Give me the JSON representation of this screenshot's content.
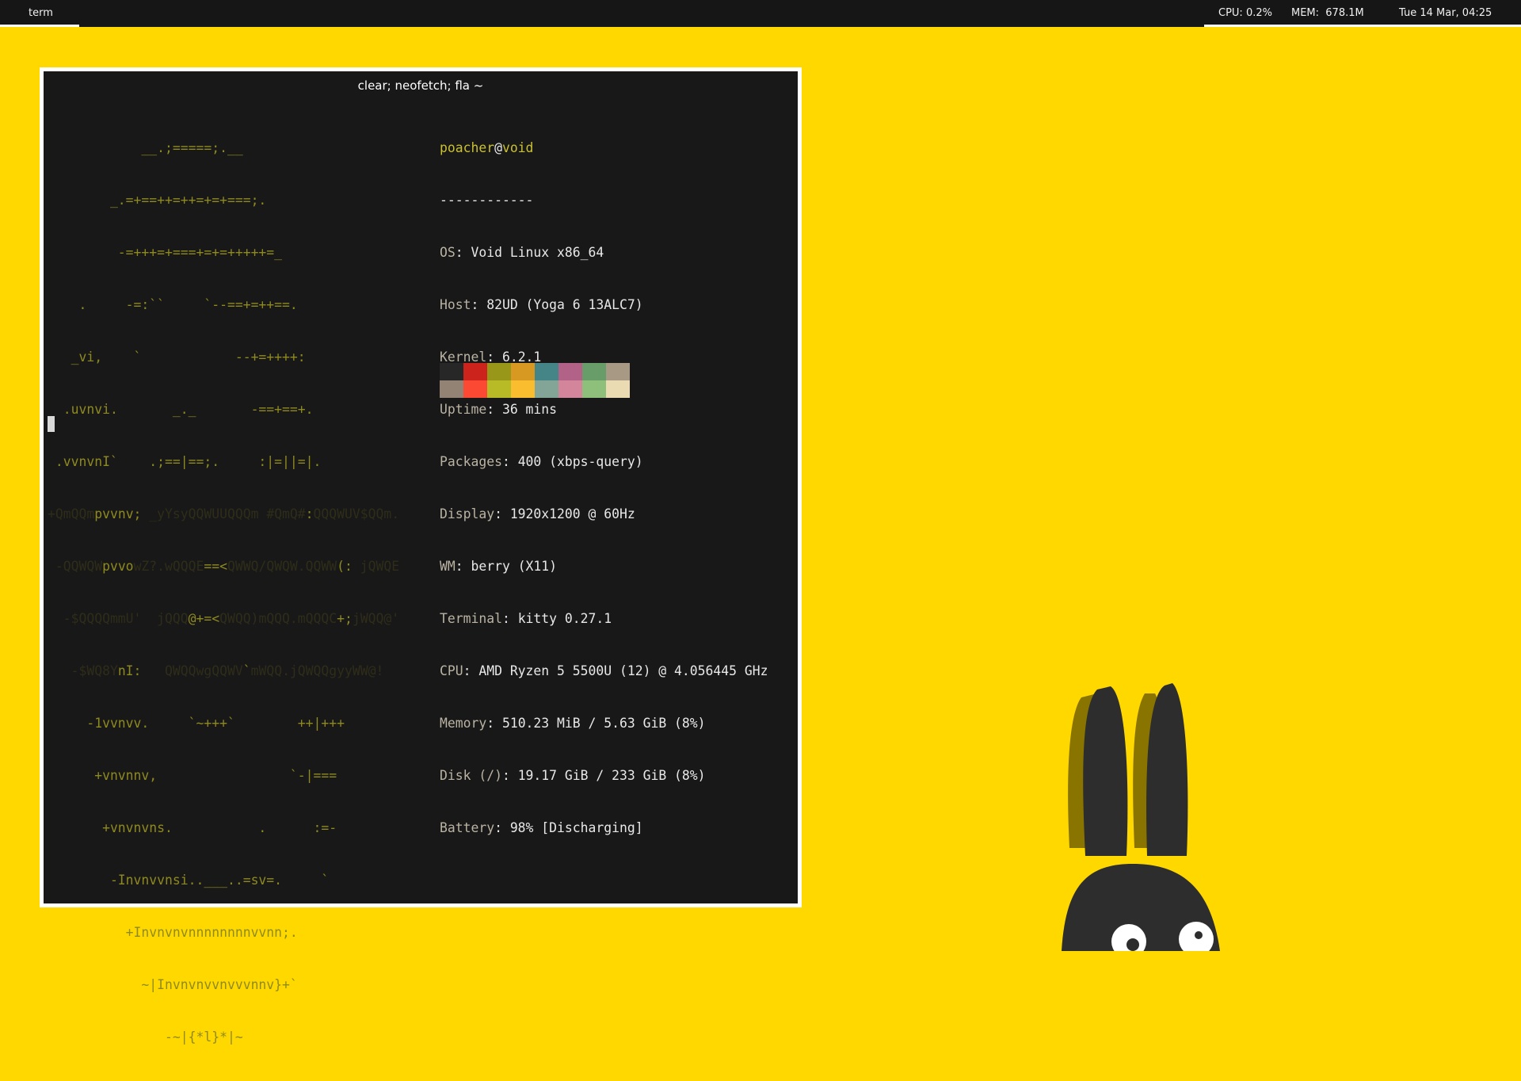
{
  "topbar": {
    "workspace": "term",
    "cpu": "CPU: 0.2%",
    "mem": "MEM:  678.1M",
    "datetime": "Tue 14 Mar, 04:25"
  },
  "terminal": {
    "title": "clear; neofetch; fla ~",
    "logo": {
      "l01": "            __.;=====;.__",
      "l02": "        _.=+==++=++=+=+===;.",
      "l03": "         -=+++=+===+=+=+++++=_",
      "l04": "    .     -=:``     `--==+=++==.",
      "l05": "   _vi,    `            --+=++++:",
      "l06": "  .uvnvi.       _._       -==+==+.",
      "l07": " .vvnvnI`    .;==|==;.     :|=||=|.",
      "l08a": "+QmQQm",
      "l08b": "pvvnv;",
      "l08c": " _yYsyQQWUUQQQm #QmQ#",
      "l08d": ":",
      "l08e": "QQQWUV$QQm.",
      "l09a": " -QQWQW",
      "l09b": "pvvo",
      "l09c": "wZ?.wQQQE",
      "l09d": "==<",
      "l09e": "QWWQ/QWQW.QQWW",
      "l09f": "(: ",
      "l09g": "jQWQE",
      "l10a": "  -$QQQQmmU'  jQQQ",
      "l10b": "@+=<",
      "l10c": "QWQQ)mQQQ.mQQQC",
      "l10d": "+;",
      "l10e": "jWQQ@'",
      "l11a": "   -$WQ8Y",
      "l11b": "nI:",
      "l11c": "   QWQQwgQQWV",
      "l11d": "`",
      "l11e": "mWQQ.jQWQQgyyWW@!",
      "l12": "     -1vvnvv.     `~+++`        ++|+++",
      "l13": "      +vnvnnv,                 `-|===",
      "l14": "       +vnvnvns.           .      :=-",
      "l15": "        -Invnvvnsi..___..=sv=.     `",
      "l16": "          +Invnvnvnnnnnnnnvvnn;.",
      "l17": "            ~|Invnvnvvnvvvnnv}+`",
      "l18": "               -~|{*l}*|~"
    },
    "info": {
      "user": "poacher",
      "at": "@",
      "host": "void",
      "separator": "------------",
      "rows": [
        {
          "key": "OS",
          "value": ": Void Linux x86_64"
        },
        {
          "key": "Host",
          "value": ": 82UD (Yoga 6 13ALC7)"
        },
        {
          "key": "Kernel",
          "value": ": 6.2.1"
        },
        {
          "key": "Uptime",
          "value": ": 36 mins"
        },
        {
          "key": "Packages",
          "value": ": 400 (xbps-query)"
        },
        {
          "key": "Display",
          "value": ": 1920x1200 @ 60Hz"
        },
        {
          "key": "WM",
          "value": ": berry (X11)"
        },
        {
          "key": "Terminal",
          "value": ": kitty 0.27.1"
        },
        {
          "key": "CPU",
          "value": ": AMD Ryzen 5 5500U (12) @ 4.056445 GHz"
        },
        {
          "key": "Memory",
          "value": ": 510.23 MiB / 5.63 GiB (8%)"
        },
        {
          "key": "Disk (/)",
          "value": ": 19.17 GiB / 233 GiB (8%)"
        },
        {
          "key": "Battery",
          "value": ": 98% [Discharging]"
        }
      ]
    },
    "palette_colors": [
      "#272727",
      "#cc241d",
      "#98971a",
      "#d79921",
      "#458588",
      "#b16286",
      "#689d6a",
      "#a89984",
      "#928374",
      "#fb4934",
      "#b8bb26",
      "#fabd2f",
      "#83a598",
      "#d3869b",
      "#8ec07c",
      "#ebdbb2"
    ]
  },
  "wallpaper": {
    "background_color": "#FFD800",
    "figure": "bunny-illustration"
  }
}
